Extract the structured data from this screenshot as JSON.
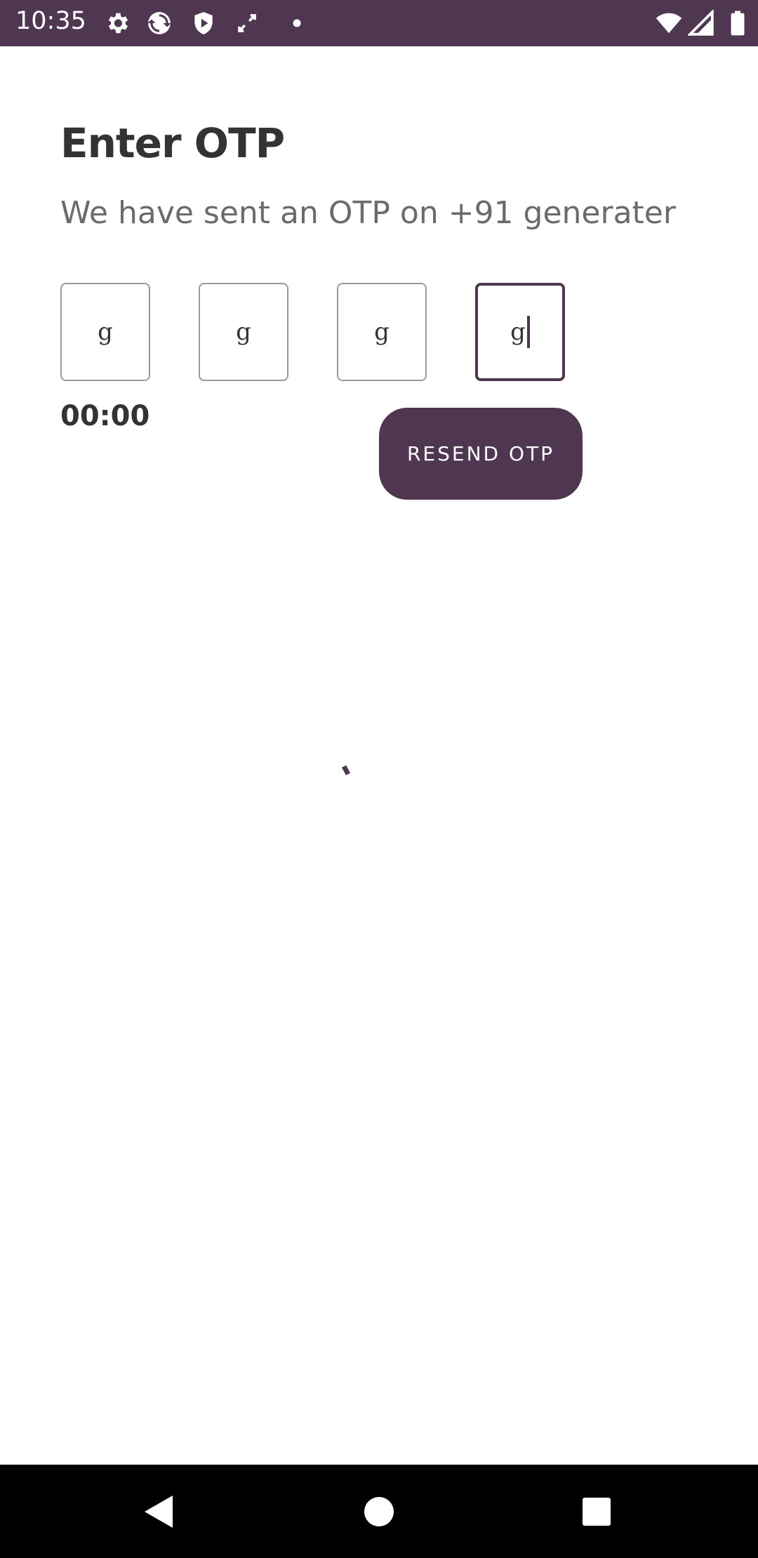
{
  "status_bar": {
    "time": "10:35",
    "background_color": "#4f3651",
    "left_icons": [
      "settings-gear-icon",
      "sync-circle-icon",
      "shield-play-icon",
      "expand-arrows-icon",
      "dot-icon"
    ],
    "right_icons": [
      "wifi-icon",
      "signal-icon",
      "battery-icon"
    ]
  },
  "page": {
    "title": "Enter OTP",
    "subtitle": "We have sent an OTP on +91 generater",
    "accent_color": "#4f3651"
  },
  "otp": {
    "digits": [
      {
        "value": "g",
        "focused": false
      },
      {
        "value": "g",
        "focused": false
      },
      {
        "value": "g",
        "focused": false
      },
      {
        "value": "g",
        "focused": true
      }
    ]
  },
  "timer": {
    "value": "00:00"
  },
  "actions": {
    "resend_label": "RESEND OTP"
  },
  "loading": {
    "visible": true,
    "icon": "loading-spinner-icon"
  },
  "nav_bar": {
    "icons": [
      "back-triangle-icon",
      "home-circle-icon",
      "recents-square-icon"
    ]
  }
}
